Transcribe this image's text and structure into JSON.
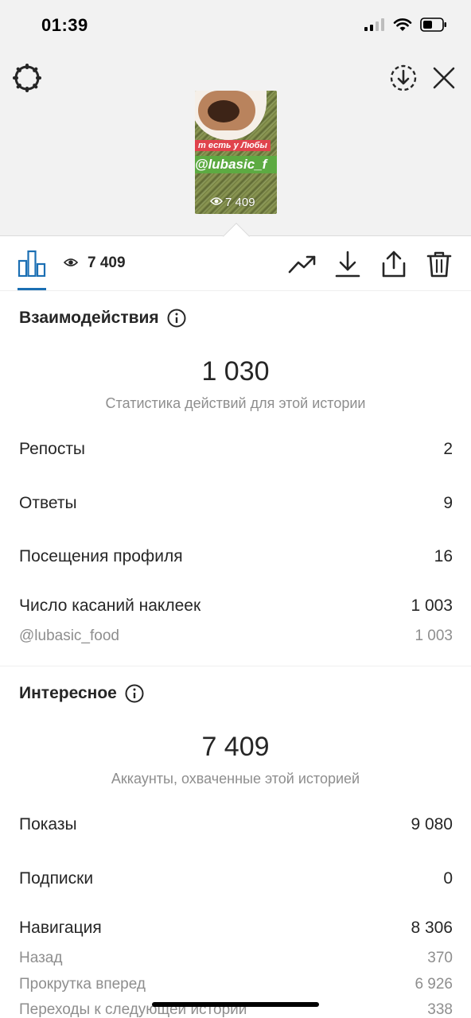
{
  "status_bar": {
    "time": "01:39",
    "icons": [
      "signal-icon",
      "wifi-icon",
      "battery-icon"
    ]
  },
  "header": {
    "settings_icon": "gear-icon",
    "download_icon": "download-circle-icon",
    "close_icon": "close-icon"
  },
  "story_thumb": {
    "label_line1": "т есть у Любы",
    "label_line2": "@lubasic_f",
    "views": "7 409"
  },
  "toolbar": {
    "views": "7 409",
    "icons": [
      "bar-chart-icon",
      "trend-icon",
      "download-icon",
      "share-icon",
      "trash-icon"
    ]
  },
  "interactions": {
    "title": "Взаимодействия",
    "total": "1 030",
    "caption": "Статистика действий для этой истории",
    "rows": [
      {
        "label": "Репосты",
        "value": "2"
      },
      {
        "label": "Ответы",
        "value": "9"
      },
      {
        "label": "Посещения профиля",
        "value": "16"
      },
      {
        "label": "Число касаний наклеек",
        "value": "1 003"
      }
    ],
    "sub_rows": [
      {
        "label": "@lubasic_food",
        "value": "1 003"
      }
    ]
  },
  "discovery": {
    "title": "Интересное",
    "total": "7 409",
    "caption": "Аккаунты, охваченные этой историей",
    "rows": [
      {
        "label": "Показы",
        "value": "9 080"
      },
      {
        "label": "Подписки",
        "value": "0"
      },
      {
        "label": "Навигация",
        "value": "8 306"
      }
    ],
    "sub_rows": [
      {
        "label": "Назад",
        "value": "370"
      },
      {
        "label": "Прокрутка вперед",
        "value": "6 926"
      },
      {
        "label": "Переходы к следующей истории",
        "value": "338"
      }
    ]
  },
  "colors": {
    "accent": "#1b6fb3",
    "text": "#262626",
    "muted": "#8e8e8e",
    "top_bg": "#f2f2f2"
  }
}
